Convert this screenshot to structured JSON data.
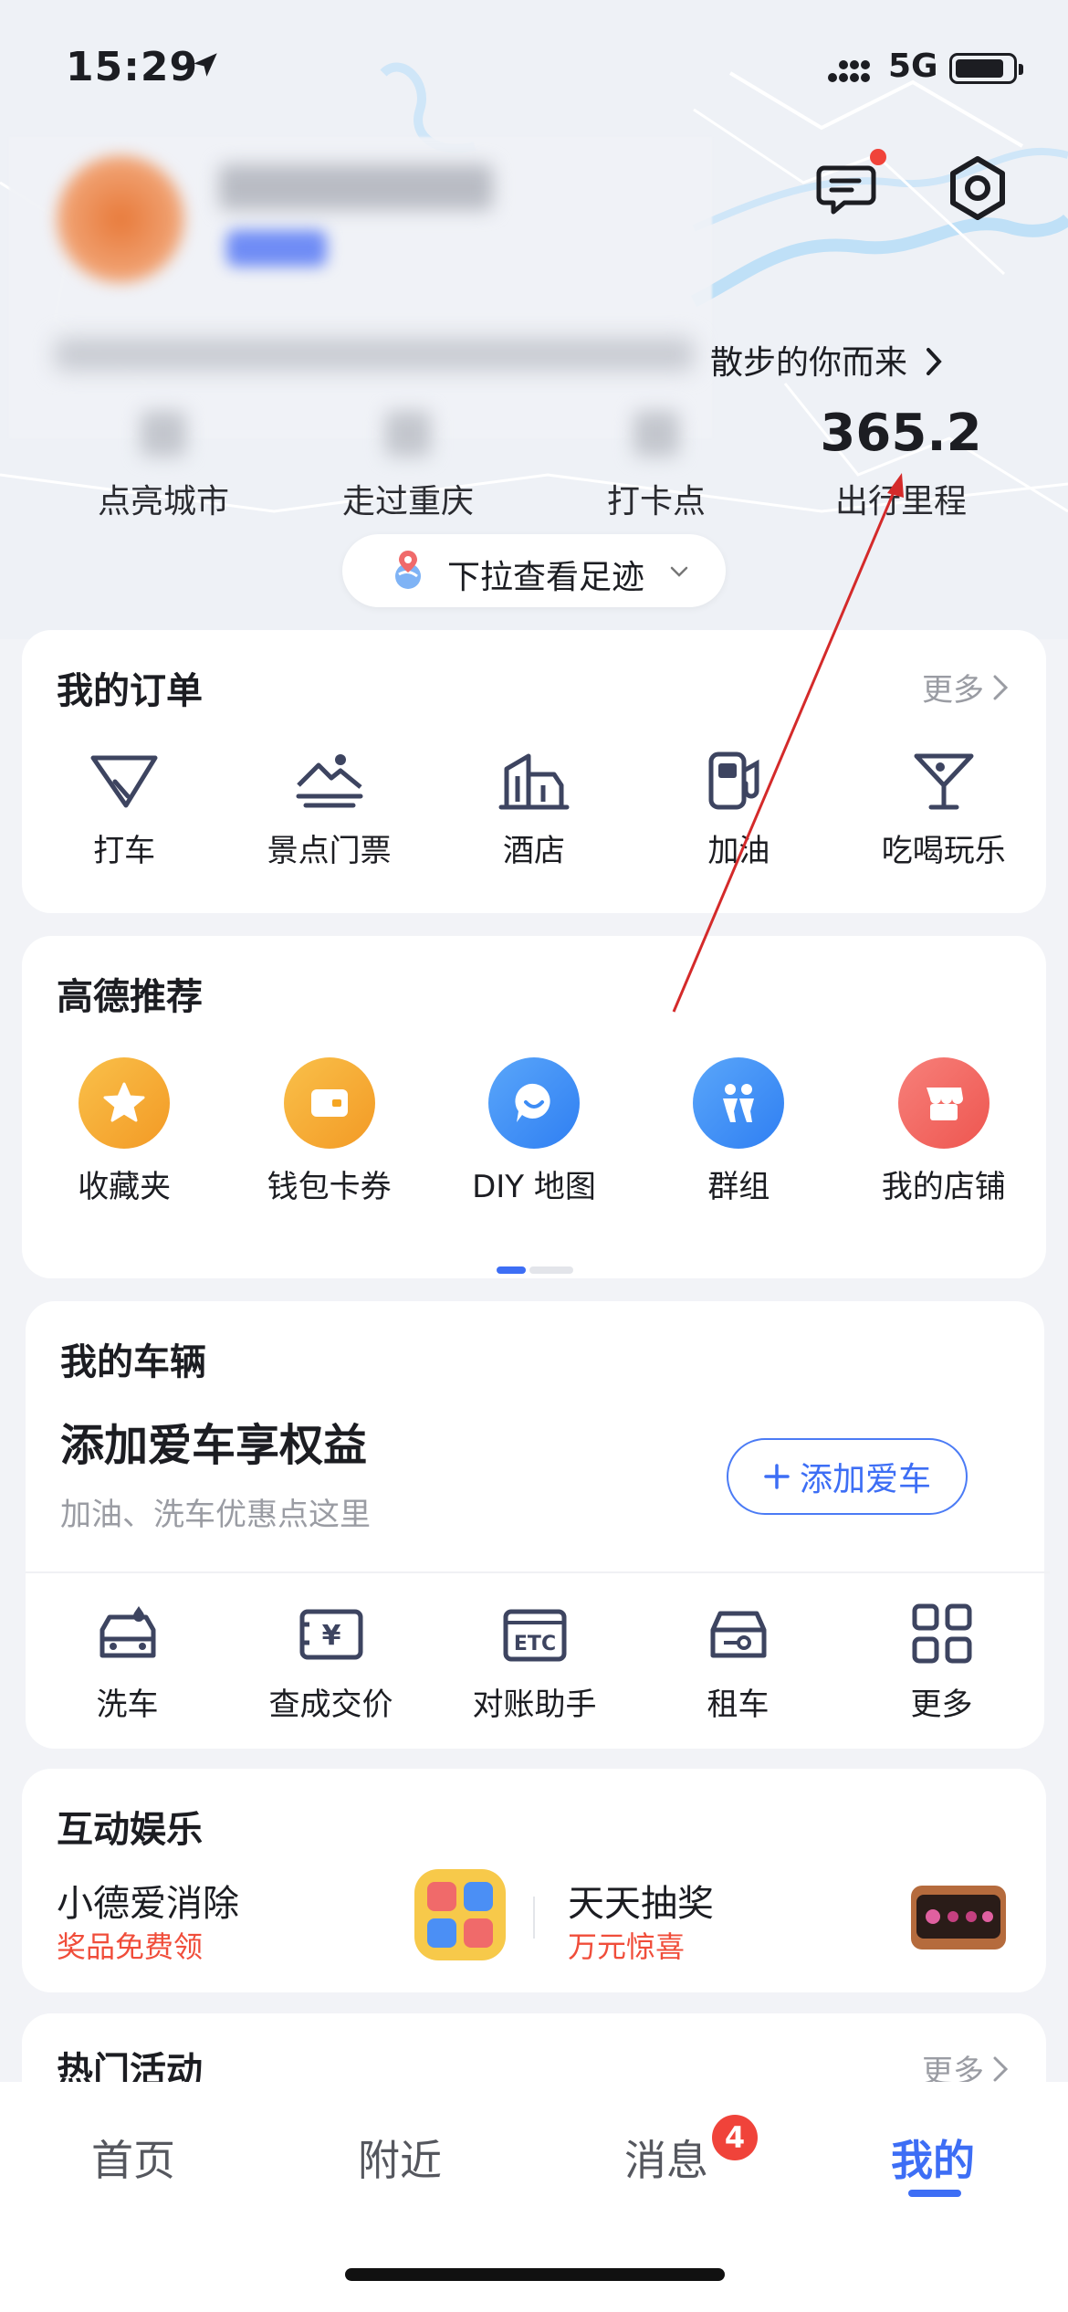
{
  "status_bar": {
    "time": "15:29",
    "network": "5G"
  },
  "header": {
    "welcome_text": "散步的你而来"
  },
  "stats": [
    {
      "value": "",
      "label": "点亮城市"
    },
    {
      "value": "",
      "label": "走过重庆"
    },
    {
      "value": "",
      "label": "打卡点"
    },
    {
      "value": "365.2",
      "label": "出行里程"
    }
  ],
  "pull_pill": {
    "label": "下拉查看足迹"
  },
  "orders": {
    "title": "我的订单",
    "more": "更多",
    "items": [
      {
        "label": "打车",
        "icon": "taxi-icon"
      },
      {
        "label": "景点门票",
        "icon": "scenic-ticket-icon"
      },
      {
        "label": "酒店",
        "icon": "hotel-icon"
      },
      {
        "label": "加油",
        "icon": "fuel-icon"
      },
      {
        "label": "吃喝玩乐",
        "icon": "cocktail-icon"
      }
    ]
  },
  "recommend": {
    "title": "高德推荐",
    "items": [
      {
        "label": "收藏夹",
        "icon": "star-icon",
        "color": "#f5a623"
      },
      {
        "label": "钱包卡券",
        "icon": "wallet-icon",
        "color": "#f5a623"
      },
      {
        "label": "DIY 地图",
        "icon": "diy-map-icon",
        "color": "#3d8cf5"
      },
      {
        "label": "群组",
        "icon": "group-icon",
        "color": "#3d8cf5"
      },
      {
        "label": "我的店铺",
        "icon": "shop-icon",
        "color": "#f0605a"
      }
    ]
  },
  "vehicle": {
    "title": "我的车辆",
    "headline": "添加爱车享权益",
    "sub": "加油、洗车优惠点这里",
    "add_button": "添加爱车",
    "items": [
      {
        "label": "洗车",
        "icon": "car-wash-icon"
      },
      {
        "label": "查成交价",
        "icon": "price-check-icon"
      },
      {
        "label": "对账助手",
        "icon": "etc-icon"
      },
      {
        "label": "租车",
        "icon": "car-rental-icon"
      },
      {
        "label": "更多",
        "icon": "grid-more-icon"
      }
    ]
  },
  "entertainment": {
    "title": "互动娱乐",
    "games": [
      {
        "title": "小德爱消除",
        "sub": "奖品免费领"
      },
      {
        "title": "天天抽奖",
        "sub": "万元惊喜"
      }
    ]
  },
  "hot": {
    "title": "热门活动",
    "more": "更多"
  },
  "tabbar": {
    "tabs": [
      {
        "label": "首页"
      },
      {
        "label": "附近"
      },
      {
        "label": "消息"
      },
      {
        "label": "我的"
      }
    ],
    "message_badge": "4"
  },
  "colors": {
    "accent": "#3d6ef5",
    "badge": "#f0433a",
    "annotation_arrow": "#d42a2a"
  }
}
